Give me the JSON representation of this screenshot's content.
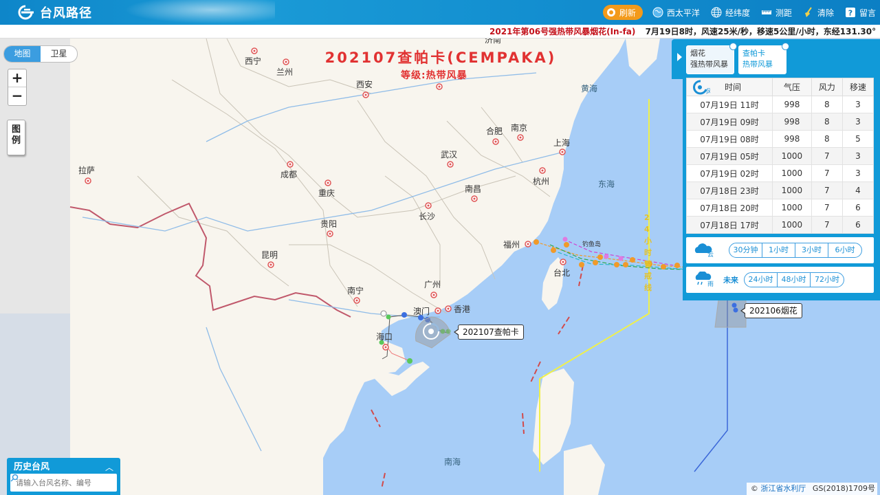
{
  "header": {
    "logo_text": "台风路径",
    "refresh_label": "刷新",
    "nav": [
      {
        "label": "西太平洋",
        "icon": "globe-icon"
      },
      {
        "label": "经纬度",
        "icon": "grid-globe-icon"
      },
      {
        "label": "测距",
        "icon": "ruler-icon"
      },
      {
        "label": "清除",
        "icon": "broom-icon"
      },
      {
        "label": "留言",
        "icon": "help-icon"
      }
    ]
  },
  "ticker": {
    "red_text": "2021年第06号强热带风暴烟花(In-fa)",
    "dark_text": "7月19日8时，风速25米/秒，移速5公里/小时，东经131.30°"
  },
  "map": {
    "title": "202107查帕卡(CEMPAKA)",
    "subtitle": "等级:热带风暴",
    "maptype": {
      "map": "地图",
      "satellite": "卫星"
    },
    "zoom_in": "+",
    "zoom_out": "−",
    "legend_btn": "图例",
    "typhoon_tags": [
      "202107查帕卡",
      "202106烟花"
    ],
    "small_label": "钓鱼岛",
    "warn_24h": "24小时警戒线",
    "cities": [
      "西宁",
      "兰州",
      "西安",
      "济南",
      "合肥",
      "南京",
      "上海",
      "杭州",
      "武汉",
      "南昌",
      "长沙",
      "福州",
      "台北",
      "广州",
      "香港",
      "澳门",
      "南宁",
      "海口",
      "贵阳",
      "昆明",
      "重庆",
      "成都",
      "拉萨"
    ],
    "seas": [
      "黄海",
      "东海",
      "南海"
    ]
  },
  "history": {
    "title": "历史台风",
    "placeholder": "请输入台风名称、编号"
  },
  "copyright": {
    "prefix": "©",
    "link": "浙江省水利厅",
    "code": "GS(2018)1709号"
  },
  "panel": {
    "tabs": [
      {
        "name": "烟花",
        "level": "强热带风暴"
      },
      {
        "name": "查帕卡",
        "level": "热带风暴"
      }
    ],
    "table": {
      "headers": [
        "时间",
        "气压",
        "风力",
        "移速"
      ],
      "rows": [
        [
          "07月19日 11时",
          "998",
          "8",
          "3"
        ],
        [
          "07月19日 09时",
          "998",
          "8",
          "3"
        ],
        [
          "07月19日 08时",
          "998",
          "8",
          "5"
        ],
        [
          "07月19日 05时",
          "1000",
          "7",
          "3"
        ],
        [
          "07月19日 02时",
          "1000",
          "7",
          "3"
        ],
        [
          "07月18日 23时",
          "1000",
          "7",
          "4"
        ],
        [
          "07月18日 20时",
          "1000",
          "7",
          "6"
        ],
        [
          "07月18日 17时",
          "1000",
          "7",
          "6"
        ]
      ]
    },
    "cloud_buttons": [
      "30分钟",
      "1小时",
      "3小时",
      "6小时"
    ],
    "rain_label": "未来",
    "rain_buttons": [
      "24小时",
      "48小时",
      "72小时"
    ],
    "icon_wind_char": "风",
    "icon_cloud_char": "云",
    "icon_rain_char": "雨"
  },
  "colors": {
    "header_blue": "#119ad8",
    "refresh_orange": "#f39a1a",
    "title_red": "#e13232",
    "warn_yellow": "#ffff44",
    "land": "#f8f5ee",
    "sea": "#a7cdf7"
  }
}
